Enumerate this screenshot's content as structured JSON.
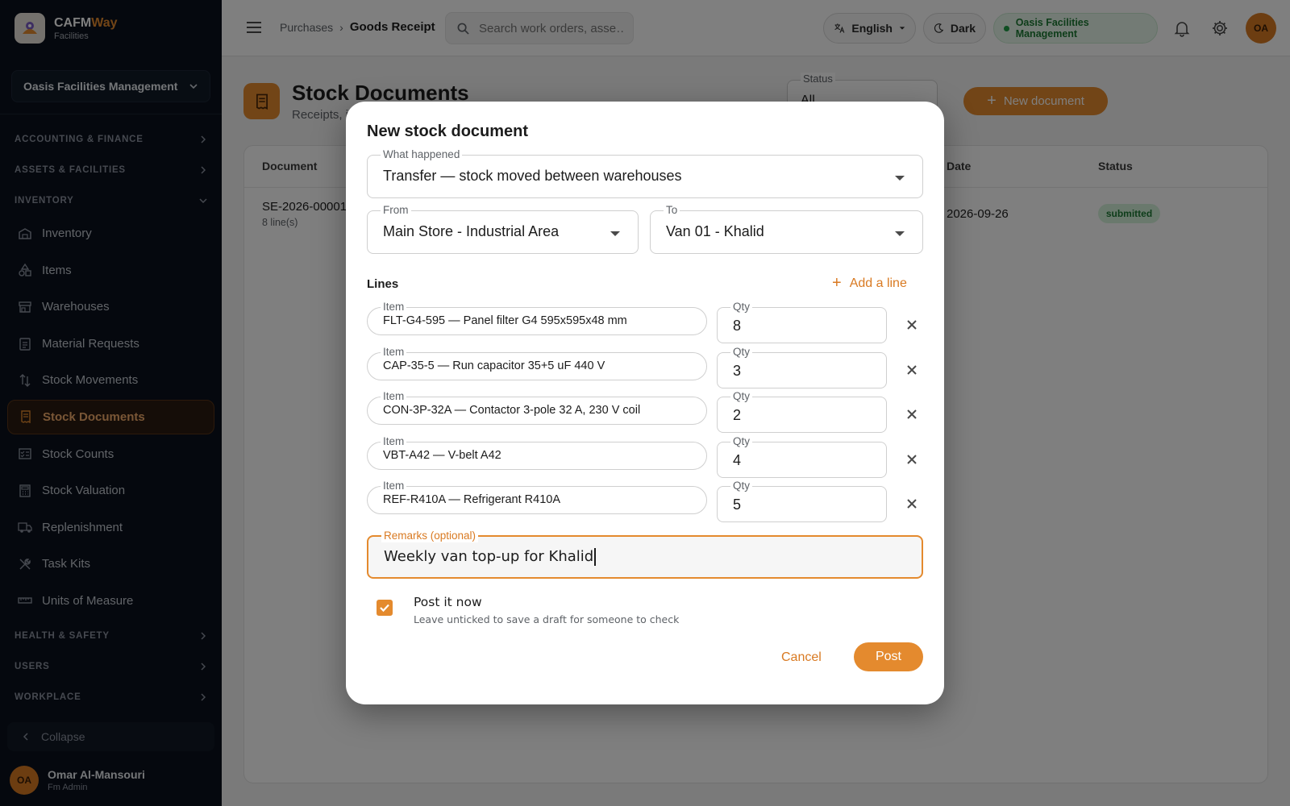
{
  "brand": {
    "name_primary": "CAFM",
    "name_accent": "Way",
    "subtitle": "Facilities"
  },
  "sidebar": {
    "org_select": "Oasis Facilities Management",
    "sections": {
      "accounting": "ACCOUNTING & FINANCE",
      "assets": "ASSETS & FACILITIES",
      "inventory": "INVENTORY",
      "health": "HEALTH & SAFETY",
      "users": "USERS",
      "workplace": "WORKPLACE"
    },
    "items": [
      {
        "label": "Inventory",
        "icon": "warehouse-icon"
      },
      {
        "label": "Items",
        "icon": "shapes-icon"
      },
      {
        "label": "Warehouses",
        "icon": "store-icon"
      },
      {
        "label": "Material Requests",
        "icon": "clipboard-icon"
      },
      {
        "label": "Stock Movements",
        "icon": "swap-icon"
      },
      {
        "label": "Stock Documents",
        "icon": "receipt-icon",
        "active": true
      },
      {
        "label": "Stock Counts",
        "icon": "checklist-icon"
      },
      {
        "label": "Stock Valuation",
        "icon": "calculator-icon"
      },
      {
        "label": "Replenishment",
        "icon": "truck-icon"
      },
      {
        "label": "Task Kits",
        "icon": "tools-icon"
      },
      {
        "label": "Units of Measure",
        "icon": "ruler-icon"
      }
    ],
    "collapse": "Collapse",
    "user": {
      "initials": "OA",
      "name": "Omar Al-Mansouri",
      "role": "Fm Admin"
    }
  },
  "topbar": {
    "breadcrumb": [
      "Purchases",
      "Goods Receipt"
    ],
    "search_placeholder": "Search work orders, asse…",
    "language": "English",
    "theme": "Dark",
    "org_badge": "Oasis Facilities Management",
    "avatar_initials": "OA"
  },
  "page": {
    "title": "Stock Documents",
    "subtitle": "Receipts, i",
    "status_filter": {
      "label": "Status",
      "value": "All"
    },
    "new_button": "New document",
    "table": {
      "headers": [
        "Document",
        "Date",
        "Status"
      ],
      "rows": [
        {
          "document": "SE-2026-00001",
          "lines": "8 line(s)",
          "date": "2026-09-26",
          "status": "submitted"
        }
      ]
    }
  },
  "dialog": {
    "title": "New stock document",
    "what_happened": {
      "label": "What happened",
      "value": "Transfer — stock moved between warehouses"
    },
    "from": {
      "label": "From",
      "value": "Main Store - Industrial Area"
    },
    "to": {
      "label": "To",
      "value": "Van 01 - Khalid"
    },
    "lines_label": "Lines",
    "add_line": "Add a line",
    "item_label": "Item",
    "qty_label": "Qty",
    "lines": [
      {
        "item": "FLT-G4-595 — Panel filter G4 595x595x48 mm",
        "qty": "8"
      },
      {
        "item": "CAP-35-5 — Run capacitor 35+5 uF 440 V",
        "qty": "3"
      },
      {
        "item": "CON-3P-32A — Contactor 3-pole 32 A, 230 V coil",
        "qty": "2"
      },
      {
        "item": "VBT-A42 — V-belt A42",
        "qty": "4"
      },
      {
        "item": "REF-R410A — Refrigerant R410A",
        "qty": "5"
      }
    ],
    "remarks": {
      "label": "Remarks (optional)",
      "value": "Weekly van top-up for Khalid"
    },
    "post_now": {
      "label": "Post it now",
      "hint": "Leave unticked to save a draft for someone to check",
      "checked": true
    },
    "cancel": "Cancel",
    "post": "Post"
  },
  "colors": {
    "accent": "#e48a2e",
    "sidebar_bg": "#0b111c",
    "success": "#1d7a34"
  }
}
